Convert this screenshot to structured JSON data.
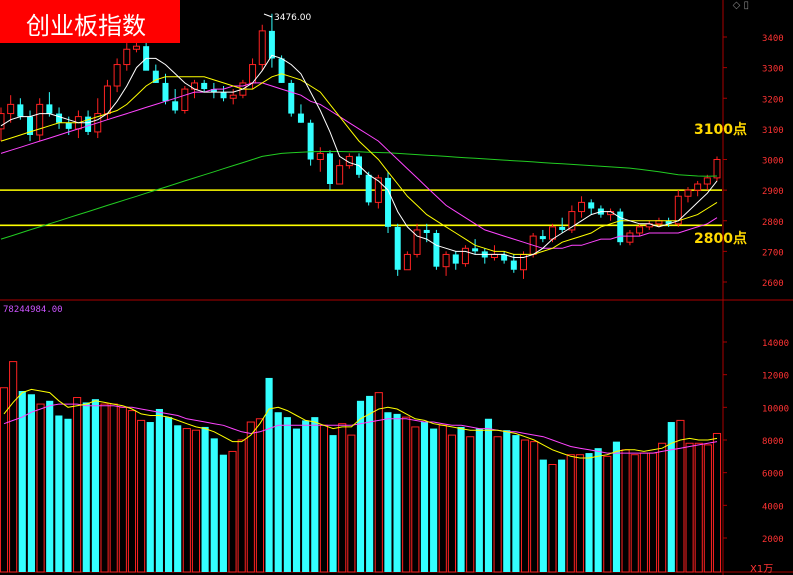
{
  "header": {
    "title": "创业板指数"
  },
  "annotations": {
    "upper_line_label": "3100点",
    "lower_line_label": "2800点",
    "peak_label": "3476.00",
    "volume_max_label": "78244984.00",
    "volume_unit": "X1万"
  },
  "corner": {
    "icons": "◇ ▯"
  },
  "colors": {
    "background": "#000000",
    "up": "#ff2222",
    "down": "#33ffff",
    "ma5": "#ffffff",
    "ma10": "#ffff00",
    "ma20": "#ff44ff",
    "ma60": "#22cc22",
    "axis": "#aa0000",
    "horizontal_lines": "#ffff00"
  },
  "chart_data": [
    {
      "type": "candlestick",
      "title": "创业板指数",
      "ylim": [
        2580,
        3520
      ],
      "yticks": [
        2600,
        2700,
        2800,
        2900,
        3000,
        3100,
        3200,
        3300,
        3400
      ],
      "horizontal_lines": [
        2900,
        2785
      ],
      "ohlc": [
        [
          3100,
          3170,
          3060,
          3150
        ],
        [
          3150,
          3210,
          3120,
          3180
        ],
        [
          3180,
          3200,
          3130,
          3140
        ],
        [
          3140,
          3160,
          3060,
          3080
        ],
        [
          3080,
          3200,
          3060,
          3180
        ],
        [
          3180,
          3220,
          3140,
          3150
        ],
        [
          3150,
          3170,
          3100,
          3120
        ],
        [
          3120,
          3140,
          3080,
          3100
        ],
        [
          3100,
          3160,
          3070,
          3140
        ],
        [
          3140,
          3160,
          3080,
          3090
        ],
        [
          3090,
          3200,
          3070,
          3150
        ],
        [
          3150,
          3260,
          3130,
          3240
        ],
        [
          3240,
          3330,
          3220,
          3310
        ],
        [
          3310,
          3380,
          3290,
          3360
        ],
        [
          3360,
          3390,
          3350,
          3370
        ],
        [
          3370,
          3390,
          3300,
          3290
        ],
        [
          3290,
          3310,
          3250,
          3250
        ],
        [
          3250,
          3280,
          3180,
          3190
        ],
        [
          3190,
          3230,
          3150,
          3160
        ],
        [
          3160,
          3240,
          3150,
          3230
        ],
        [
          3230,
          3260,
          3200,
          3250
        ],
        [
          3250,
          3260,
          3220,
          3230
        ],
        [
          3230,
          3250,
          3200,
          3220
        ],
        [
          3220,
          3240,
          3190,
          3200
        ],
        [
          3200,
          3230,
          3180,
          3210
        ],
        [
          3210,
          3260,
          3200,
          3250
        ],
        [
          3250,
          3330,
          3230,
          3310
        ],
        [
          3310,
          3440,
          3290,
          3420
        ],
        [
          3420,
          3476,
          3300,
          3330
        ],
        [
          3330,
          3340,
          3250,
          3250
        ],
        [
          3250,
          3260,
          3140,
          3150
        ],
        [
          3150,
          3180,
          3120,
          3120
        ],
        [
          3120,
          3130,
          2980,
          3000
        ],
        [
          3000,
          3040,
          2960,
          3020
        ],
        [
          3020,
          3030,
          2900,
          2920
        ],
        [
          2920,
          3000,
          2920,
          2980
        ],
        [
          2980,
          3020,
          2970,
          3010
        ],
        [
          3010,
          3020,
          2940,
          2950
        ],
        [
          2950,
          2960,
          2850,
          2860
        ],
        [
          2860,
          2950,
          2840,
          2940
        ],
        [
          2940,
          2960,
          2760,
          2780
        ],
        [
          2780,
          2790,
          2620,
          2640
        ],
        [
          2640,
          2700,
          2640,
          2690
        ],
        [
          2690,
          2790,
          2680,
          2770
        ],
        [
          2770,
          2790,
          2730,
          2760
        ],
        [
          2760,
          2770,
          2640,
          2650
        ],
        [
          2650,
          2700,
          2620,
          2690
        ],
        [
          2690,
          2700,
          2640,
          2660
        ],
        [
          2660,
          2720,
          2650,
          2710
        ],
        [
          2710,
          2740,
          2690,
          2700
        ],
        [
          2700,
          2710,
          2660,
          2680
        ],
        [
          2680,
          2720,
          2670,
          2690
        ],
        [
          2690,
          2700,
          2660,
          2670
        ],
        [
          2670,
          2690,
          2630,
          2640
        ],
        [
          2640,
          2700,
          2610,
          2690
        ],
        [
          2690,
          2760,
          2680,
          2750
        ],
        [
          2750,
          2770,
          2730,
          2740
        ],
        [
          2740,
          2790,
          2730,
          2780
        ],
        [
          2780,
          2810,
          2760,
          2770
        ],
        [
          2770,
          2850,
          2760,
          2830
        ],
        [
          2830,
          2880,
          2810,
          2860
        ],
        [
          2860,
          2870,
          2820,
          2840
        ],
        [
          2840,
          2850,
          2810,
          2820
        ],
        [
          2820,
          2840,
          2800,
          2830
        ],
        [
          2830,
          2840,
          2720,
          2730
        ],
        [
          2730,
          2770,
          2720,
          2760
        ],
        [
          2760,
          2790,
          2750,
          2780
        ],
        [
          2780,
          2800,
          2770,
          2790
        ],
        [
          2790,
          2810,
          2780,
          2800
        ],
        [
          2800,
          2810,
          2780,
          2790
        ],
        [
          2790,
          2900,
          2780,
          2880
        ],
        [
          2880,
          2910,
          2860,
          2900
        ],
        [
          2900,
          2930,
          2880,
          2920
        ],
        [
          2920,
          2950,
          2900,
          2940
        ],
        [
          2940,
          3010,
          2930,
          3000
        ]
      ],
      "ma5": [
        3110,
        3130,
        3140,
        3140,
        3150,
        3150,
        3140,
        3130,
        3120,
        3120,
        3130,
        3150,
        3190,
        3240,
        3300,
        3330,
        3330,
        3310,
        3280,
        3250,
        3230,
        3220,
        3220,
        3220,
        3220,
        3230,
        3250,
        3290,
        3340,
        3330,
        3310,
        3280,
        3220,
        3160,
        3090,
        3010,
        2990,
        2980,
        2950,
        2930,
        2900,
        2830,
        2780,
        2750,
        2740,
        2720,
        2710,
        2700,
        2700,
        2690,
        2690,
        2690,
        2690,
        2680,
        2680,
        2690,
        2710,
        2740,
        2760,
        2780,
        2800,
        2820,
        2830,
        2830,
        2810,
        2800,
        2790,
        2790,
        2780,
        2790,
        2800,
        2830,
        2860,
        2890,
        2930
      ],
      "ma10": [
        3060,
        3070,
        3080,
        3090,
        3100,
        3110,
        3120,
        3120,
        3120,
        3130,
        3140,
        3150,
        3160,
        3180,
        3210,
        3240,
        3260,
        3270,
        3270,
        3270,
        3270,
        3270,
        3260,
        3250,
        3240,
        3230,
        3230,
        3250,
        3270,
        3280,
        3270,
        3260,
        3240,
        3220,
        3180,
        3140,
        3100,
        3060,
        3030,
        3000,
        2960,
        2920,
        2880,
        2850,
        2820,
        2800,
        2780,
        2760,
        2740,
        2720,
        2710,
        2700,
        2700,
        2690,
        2690,
        2690,
        2700,
        2710,
        2730,
        2740,
        2750,
        2760,
        2780,
        2790,
        2800,
        2800,
        2800,
        2800,
        2800,
        2800,
        2800,
        2810,
        2820,
        2840,
        2860
      ],
      "ma20": [
        3020,
        3030,
        3040,
        3050,
        3060,
        3070,
        3080,
        3090,
        3100,
        3110,
        3120,
        3130,
        3140,
        3150,
        3160,
        3170,
        3180,
        3190,
        3200,
        3210,
        3220,
        3220,
        3230,
        3230,
        3240,
        3240,
        3250,
        3250,
        3240,
        3230,
        3220,
        3210,
        3190,
        3180,
        3160,
        3140,
        3120,
        3100,
        3080,
        3060,
        3030,
        3000,
        2970,
        2940,
        2910,
        2880,
        2850,
        2830,
        2810,
        2790,
        2770,
        2760,
        2750,
        2740,
        2730,
        2720,
        2710,
        2710,
        2710,
        2720,
        2720,
        2730,
        2740,
        2740,
        2750,
        2750,
        2750,
        2760,
        2760,
        2760,
        2760,
        2770,
        2780,
        2790,
        2810
      ],
      "ma60": [
        2740,
        2750,
        2760,
        2770,
        2780,
        2790,
        2800,
        2810,
        2820,
        2830,
        2840,
        2850,
        2860,
        2870,
        2880,
        2890,
        2900,
        2910,
        2920,
        2930,
        2940,
        2950,
        2960,
        2970,
        2980,
        2990,
        3000,
        3010,
        3015,
        3020,
        3022,
        3024,
        3025,
        3026,
        3026,
        3026,
        3025,
        3025,
        3024,
        3023,
        3022,
        3020,
        3018,
        3016,
        3014,
        3012,
        3010,
        3008,
        3006,
        3004,
        3002,
        3000,
        2998,
        2996,
        2994,
        2992,
        2990,
        2988,
        2986,
        2984,
        2982,
        2980,
        2978,
        2976,
        2974,
        2972,
        2968,
        2964,
        2960,
        2955,
        2950,
        2948,
        2946,
        2945,
        2946
      ]
    },
    {
      "type": "bar",
      "title": "78244984.00",
      "ylabel": "X1万",
      "ylim": [
        0,
        15500
      ],
      "yticks": [
        2000,
        4000,
        6000,
        8000,
        10000,
        12000,
        14000
      ],
      "values": [
        11200,
        12800,
        11000,
        10800,
        10200,
        10400,
        9500,
        9300,
        10600,
        10300,
        10500,
        10200,
        10200,
        10000,
        9800,
        9200,
        9100,
        9900,
        9400,
        8900,
        8700,
        8600,
        8800,
        8100,
        7100,
        7300,
        8000,
        9100,
        9300,
        11800,
        9700,
        9400,
        8700,
        9200,
        9400,
        8900,
        8300,
        9000,
        8300,
        10400,
        10700,
        10900,
        9700,
        9600,
        9400,
        8800,
        9100,
        8700,
        8900,
        8300,
        8800,
        8200,
        8700,
        9300,
        8200,
        8600,
        8300,
        8000,
        7900,
        6800,
        6500,
        6800,
        7100,
        7100,
        7200,
        7500,
        7000,
        7900,
        7400,
        7100,
        7200,
        7200,
        7800,
        9100,
        9200,
        7800,
        7800,
        7700,
        8400
      ],
      "ma5": [
        9600,
        10300,
        10900,
        11100,
        11000,
        10900,
        10400,
        10000,
        10100,
        10200,
        10400,
        10300,
        10200,
        10100,
        9900,
        9600,
        9500,
        9500,
        9400,
        9200,
        9000,
        8800,
        8700,
        8500,
        8200,
        7900,
        7900,
        8300,
        9000,
        9900,
        10000,
        9800,
        9500,
        9200,
        9100,
        8900,
        8700,
        8800,
        8800,
        9300,
        9600,
        9900,
        10000,
        9900,
        9600,
        9300,
        9200,
        9000,
        8900,
        8800,
        8700,
        8600,
        8600,
        8600,
        8600,
        8500,
        8400,
        8200,
        8000,
        7700,
        7400,
        7200,
        7000,
        6900,
        6900,
        7000,
        7100,
        7300,
        7400,
        7400,
        7300,
        7400,
        7500,
        7800,
        8000,
        8100,
        8000,
        8000,
        8100
      ],
      "ma10": [
        9000,
        9200,
        9400,
        9700,
        9900,
        10100,
        10200,
        10200,
        10200,
        10100,
        10100,
        10100,
        10100,
        10000,
        10000,
        9900,
        9800,
        9700,
        9600,
        9500,
        9300,
        9200,
        9100,
        9000,
        8900,
        8700,
        8500,
        8400,
        8500,
        8700,
        8900,
        8900,
        8900,
        8900,
        8900,
        8900,
        8900,
        8900,
        8900,
        9000,
        9100,
        9200,
        9300,
        9300,
        9300,
        9200,
        9100,
        9100,
        9000,
        8900,
        8900,
        8800,
        8700,
        8700,
        8600,
        8500,
        8500,
        8400,
        8300,
        8200,
        8000,
        7800,
        7600,
        7500,
        7400,
        7300,
        7200,
        7200,
        7200,
        7200,
        7200,
        7200,
        7300,
        7400,
        7500,
        7600,
        7700,
        7800,
        7900
      ]
    }
  ]
}
